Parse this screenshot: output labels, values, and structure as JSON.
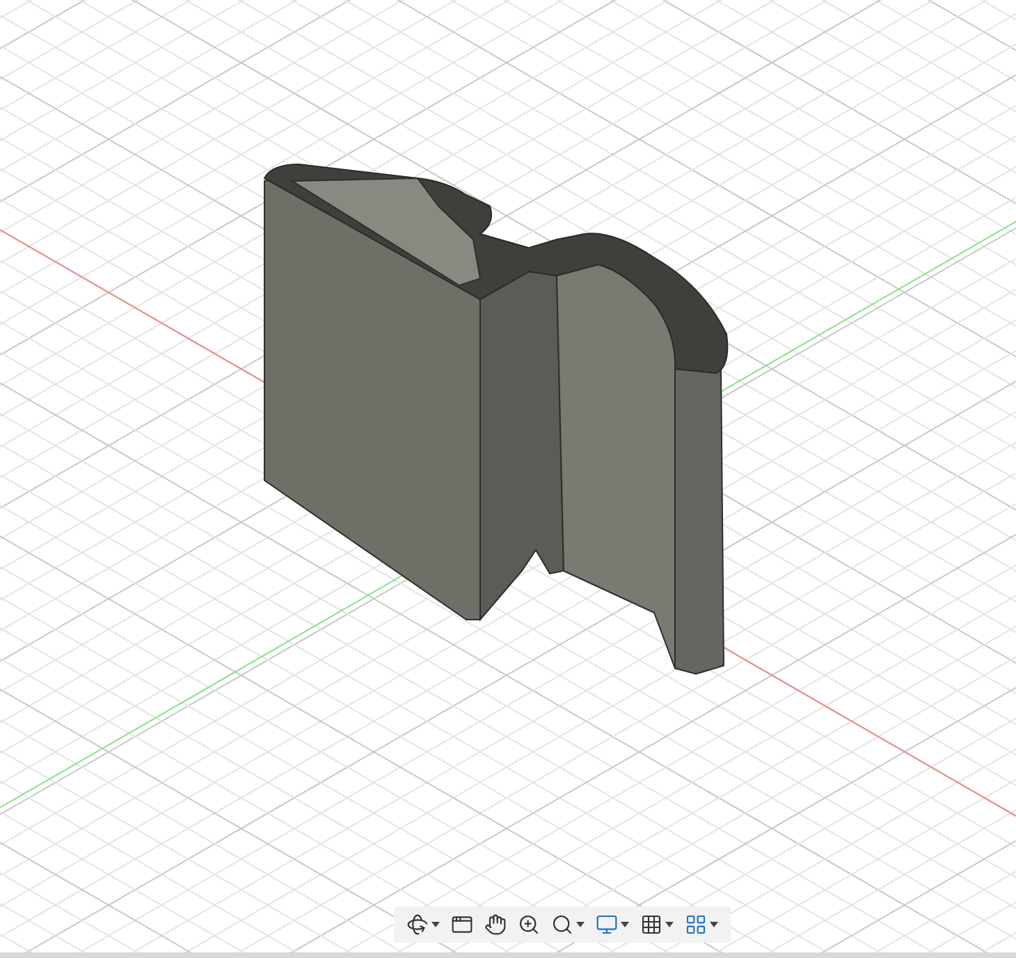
{
  "toolbar": [
    {
      "kind": "orbit",
      "dropdown": true
    },
    {
      "kind": "look",
      "dropdown": false
    },
    {
      "kind": "pan",
      "dropdown": false
    },
    {
      "kind": "zoom",
      "dropdown": false
    },
    {
      "kind": "fit",
      "dropdown": true
    },
    {
      "kind": "display",
      "dropdown": true
    },
    {
      "kind": "grid",
      "dropdown": true
    },
    {
      "kind": "viewports",
      "dropdown": true
    }
  ]
}
